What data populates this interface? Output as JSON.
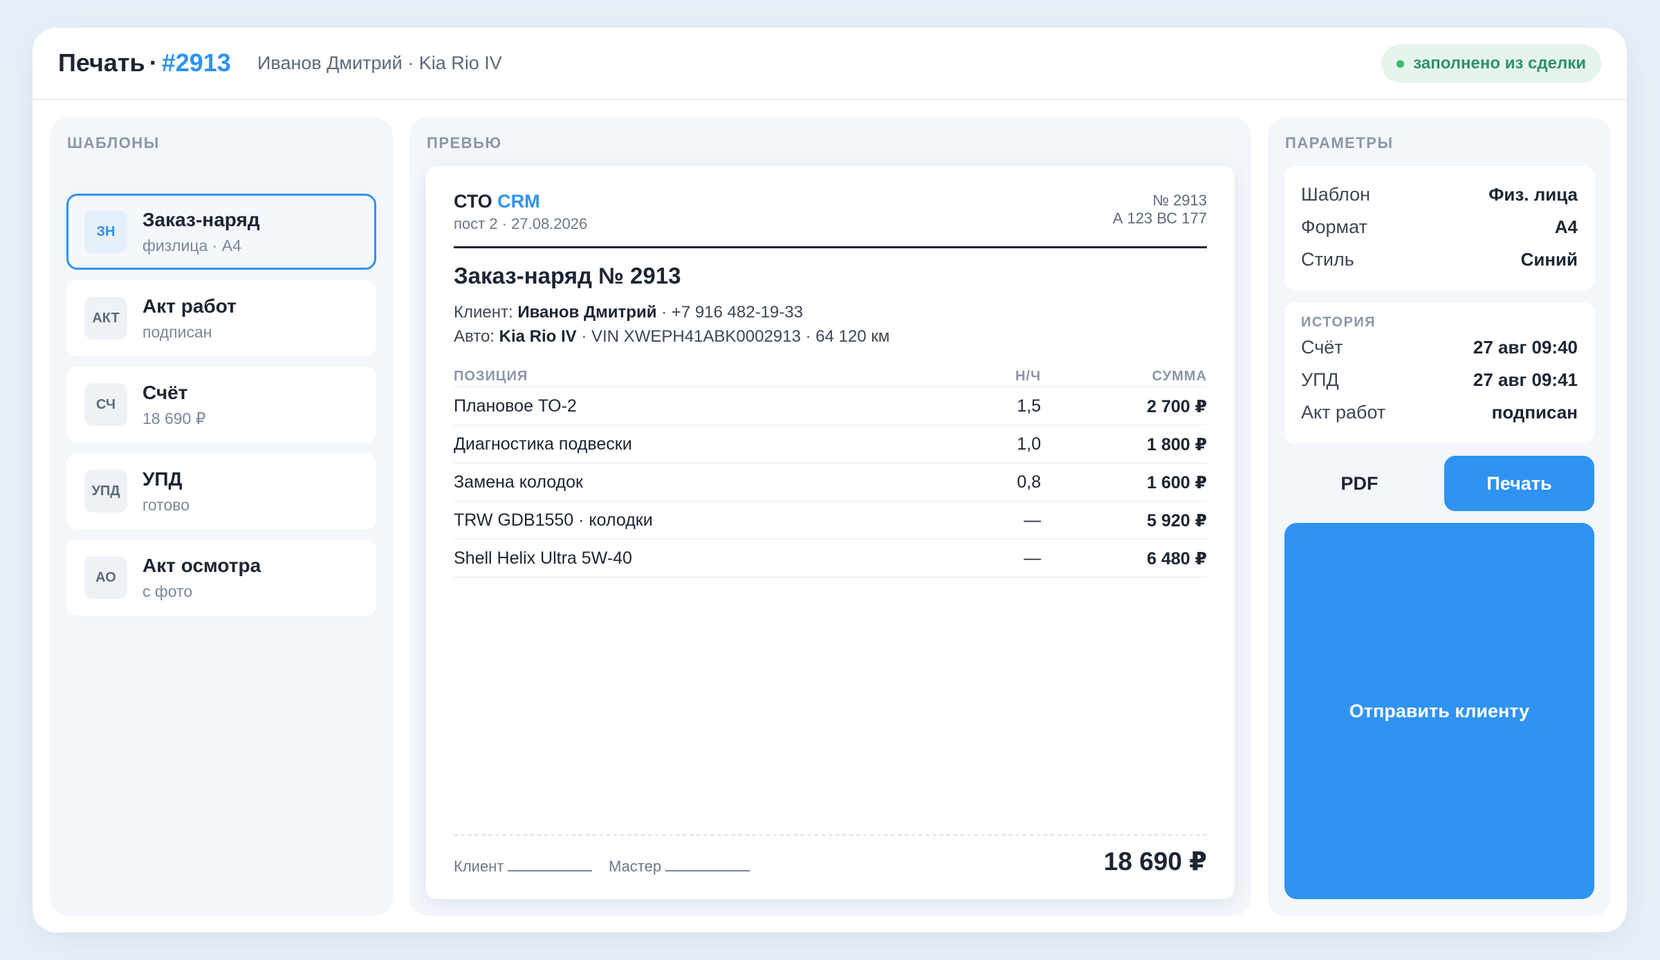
{
  "header": {
    "title": "Печать",
    "separator": "·",
    "order_number": "#2913",
    "subtitle": "Иванов Дмитрий · Kia Rio IV",
    "badge": "заполнено из сделки"
  },
  "templates": {
    "title": "ШАБЛОНЫ",
    "items": [
      {
        "icon": "ЗН",
        "name": "Заказ-наряд",
        "sub": "физлица · A4"
      },
      {
        "icon": "АКТ",
        "name": "Акт работ",
        "sub": "подписан"
      },
      {
        "icon": "СЧ",
        "name": "Счёт",
        "sub": "18 690 ₽"
      },
      {
        "icon": "УПД",
        "name": "УПД",
        "sub": "готово"
      },
      {
        "icon": "АО",
        "name": "Акт осмотра",
        "sub": "с фото"
      }
    ]
  },
  "preview": {
    "title": "ПРЕВЬЮ",
    "doc": {
      "brand": "СТО",
      "brand_accent": "CRM",
      "post_date": "пост 2 · 27.08.2026",
      "doc_no": "№ 2913",
      "plate": "А 123 ВС 177",
      "title": "Заказ-наряд № 2913",
      "client_label": "Клиент:",
      "client_name": "Иванов Дмитрий",
      "client_phone": "· +7 916 482-19-33",
      "car_label": "Авто:",
      "car_model": "Kia Rio IV",
      "car_details": "· VIN XWEPH41ABK0002913 · 64 120 км",
      "columns": [
        "ПОЗИЦИЯ",
        "Н/Ч",
        "СУММА"
      ],
      "rows": [
        [
          "Плановое ТО-2",
          "1,5",
          "2 700 ₽"
        ],
        [
          "Диагностика подвески",
          "1,0",
          "1 800 ₽"
        ],
        [
          "Замена колодок",
          "0,8",
          "1 600 ₽"
        ],
        [
          "TRW GDB1550 · колодки",
          "—",
          "5 920 ₽"
        ],
        [
          "Shell Helix Ultra 5W-40",
          "—",
          "6 480 ₽"
        ]
      ],
      "sign_client": "Клиент",
      "sign_master": "Мастер",
      "total": "18 690 ₽"
    }
  },
  "params": {
    "title": "ПАРАМЕТРЫ",
    "settings": [
      {
        "k": "Шаблон",
        "v": "Физ. лица"
      },
      {
        "k": "Формат",
        "v": "A4"
      },
      {
        "k": "Стиль",
        "v": "Синий"
      }
    ],
    "history_title": "ИСТОРИЯ",
    "history": [
      {
        "k": "Счёт",
        "v": "27 авг 09:40"
      },
      {
        "k": "УПД",
        "v": "27 авг 09:41"
      },
      {
        "k": "Акт работ",
        "v": "подписан"
      }
    ],
    "pdf_label": "PDF",
    "print_label": "Печать",
    "send_label": "Отправить клиенту"
  },
  "colors": {
    "accent": "#2f93f2",
    "success": "#3cb878",
    "background": "#e8f0f9"
  }
}
